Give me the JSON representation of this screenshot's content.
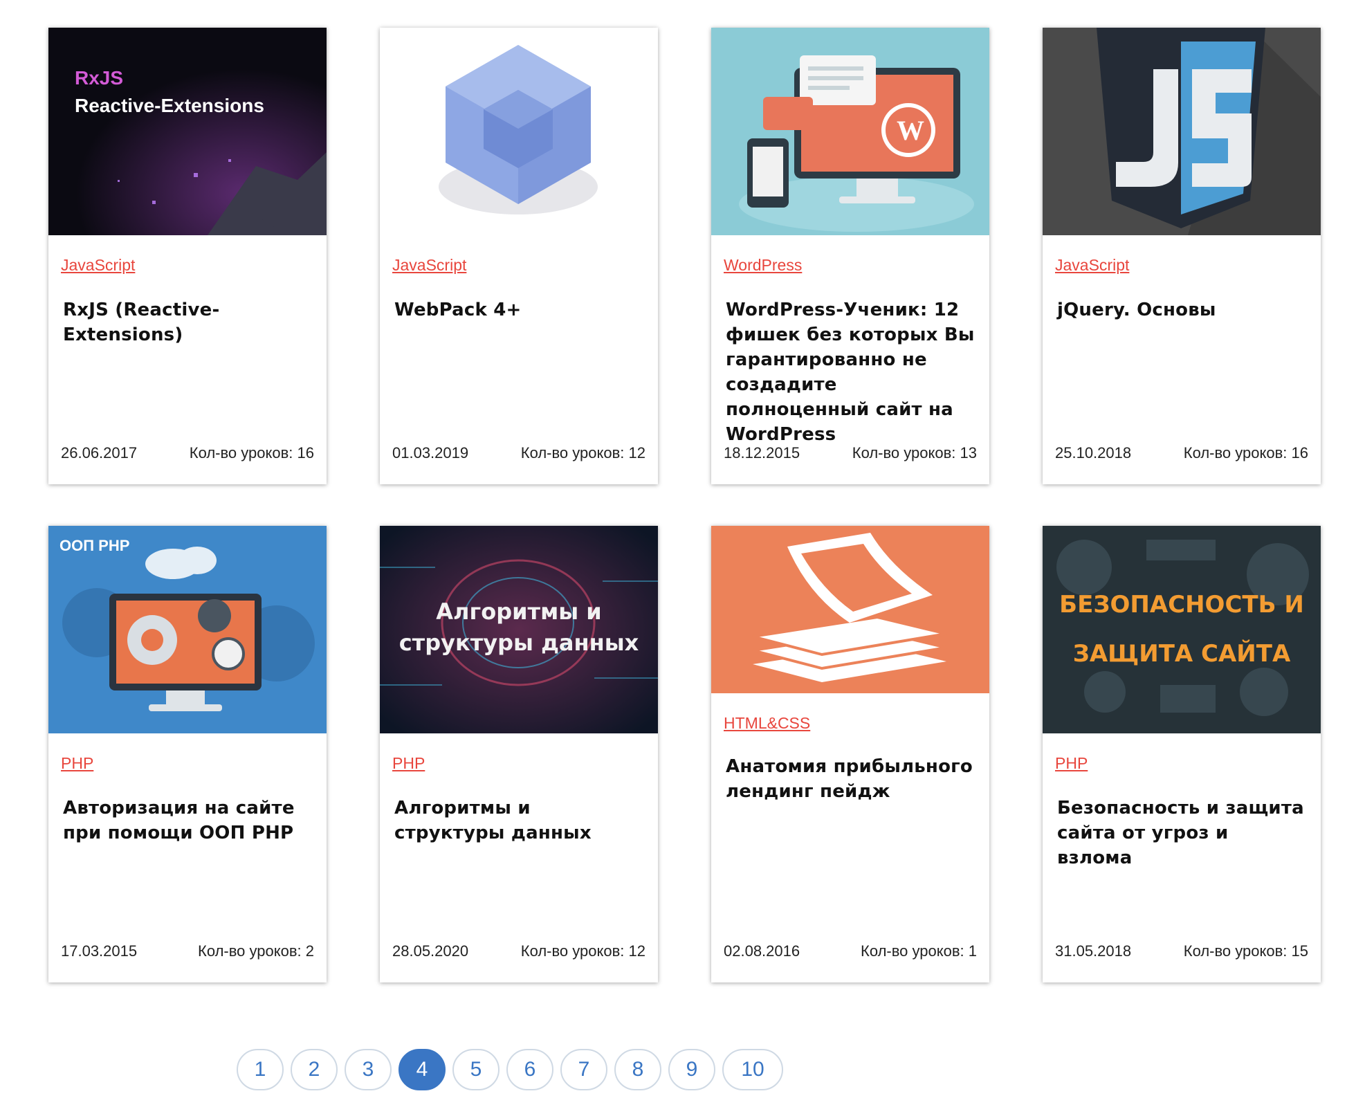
{
  "cards": [
    {
      "category": "JavaScript",
      "title": "RxJS (Reactive-Extensions)",
      "date": "26.06.2017",
      "lessons": "Кол-во уроков: 16",
      "img_text": [
        "RxJS",
        "Reactive-Extensions"
      ]
    },
    {
      "category": "JavaScript",
      "title": "WebPack 4+",
      "date": "01.03.2019",
      "lessons": "Кол-во уроков: 12"
    },
    {
      "category": "WordPress",
      "title": "WordPress-Ученик: 12 фишек без которых Вы гарантированно не создадите полноценный сайт на WordPress",
      "date": "18.12.2015",
      "lessons": "Кол-во уроков: 13"
    },
    {
      "category": "JavaScript",
      "title": "jQuery. Основы",
      "date": "25.10.2018",
      "lessons": "Кол-во уроков: 16"
    },
    {
      "category": "PHP",
      "title": "Авторизация на сайте при помощи ООП PHP",
      "date": "17.03.2015",
      "lessons": "Кол-во уроков: 2",
      "img_text": [
        "ООП PHP"
      ]
    },
    {
      "category": "PHP",
      "title": "Алгоритмы и структуры данных",
      "date": "28.05.2020",
      "lessons": "Кол-во уроков: 12",
      "img_text": [
        "Алгоритмы и",
        "структуры данных"
      ]
    },
    {
      "category": "HTML&CSS",
      "title": "Анатомия прибыльного лендинг пейдж",
      "date": "02.08.2016",
      "lessons": "Кол-во уроков: 1"
    },
    {
      "category": "PHP",
      "title": "Безопасность и защита сайта от угроз и взлома",
      "date": "31.05.2018",
      "lessons": "Кол-во уроков: 15",
      "img_text": [
        "БЕЗОПАСНОСТЬ И",
        "ЗАЩИТА САЙТА"
      ]
    }
  ],
  "pagination": {
    "pages": [
      "1",
      "2",
      "3",
      "4",
      "5",
      "6",
      "7",
      "8",
      "9",
      "10"
    ],
    "current": "4"
  },
  "colors": {
    "category": "#e8463d",
    "page_active": "#3a76c4",
    "page_text": "#3a76c4",
    "page_border": "#cfd9e4"
  }
}
